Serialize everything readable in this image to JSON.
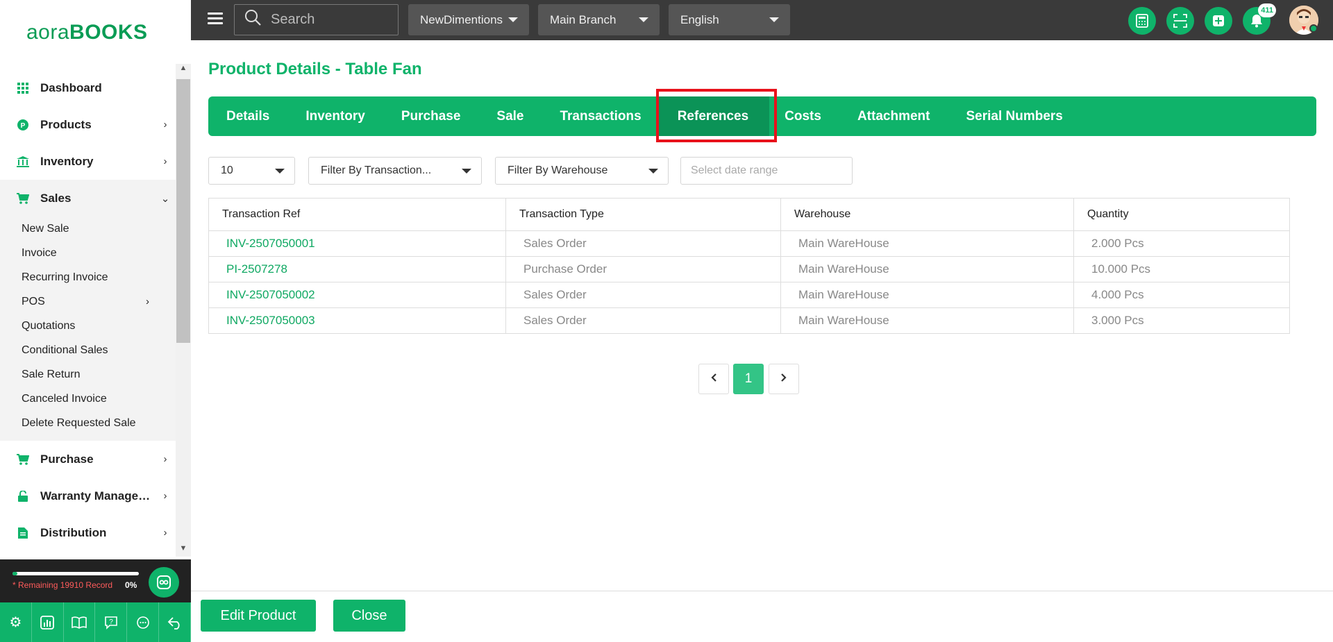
{
  "sidebar": {
    "logo_left": "aora",
    "logo_right": "BOOKS",
    "items": [
      {
        "label": "Dashboard",
        "icon": "grid-icon"
      },
      {
        "label": "Products",
        "icon": "product-icon"
      },
      {
        "label": "Inventory",
        "icon": "bank-icon"
      },
      {
        "label": "Sales",
        "icon": "cart-icon"
      },
      {
        "label": "Purchase",
        "icon": "cart-icon"
      },
      {
        "label": "Warranty Management",
        "icon": "lock-icon"
      },
      {
        "label": "Distribution",
        "icon": "document-icon"
      }
    ],
    "sales_sub": [
      "New Sale",
      "Invoice",
      "Recurring Invoice",
      "POS",
      "Quotations",
      "Conditional Sales",
      "Sale Return",
      "Canceled Invoice",
      "Delete Requested Sale"
    ],
    "remaining_text": "* Remaining 19910 Record",
    "progress_pct": "0%",
    "progress_value": 0.02
  },
  "topbar": {
    "search_placeholder": "Search",
    "company": "NewDimentions",
    "branch": "Main Branch",
    "language": "English",
    "notification_count": "411"
  },
  "page": {
    "title": "Product Details - Table Fan",
    "tabs": [
      "Details",
      "Inventory",
      "Purchase",
      "Sale",
      "Transactions",
      "References",
      "Costs",
      "Attachment",
      "Serial Numbers"
    ],
    "active_tab": "References"
  },
  "filters": {
    "page_size": "10",
    "transaction_filter": "Filter By Transaction...",
    "warehouse_filter": "Filter By Warehouse",
    "date_placeholder": "Select date range"
  },
  "table": {
    "headers": [
      "Transaction Ref",
      "Transaction Type",
      "Warehouse",
      "Quantity"
    ],
    "rows": [
      [
        "INV-2507050001",
        "Sales Order",
        "Main WareHouse",
        "2.000 Pcs"
      ],
      [
        "PI-2507278",
        "Purchase Order",
        "Main WareHouse",
        "10.000 Pcs"
      ],
      [
        "INV-2507050002",
        "Sales Order",
        "Main WareHouse",
        "4.000 Pcs"
      ],
      [
        "INV-2507050003",
        "Sales Order",
        "Main WareHouse",
        "3.000 Pcs"
      ]
    ]
  },
  "pagination": {
    "current": "1"
  },
  "footer": {
    "edit_label": "Edit Product",
    "close_label": "Close"
  },
  "colors": {
    "accent": "#0fb36a",
    "highlight": "#e8121b",
    "topbar": "#3a3a3a"
  }
}
